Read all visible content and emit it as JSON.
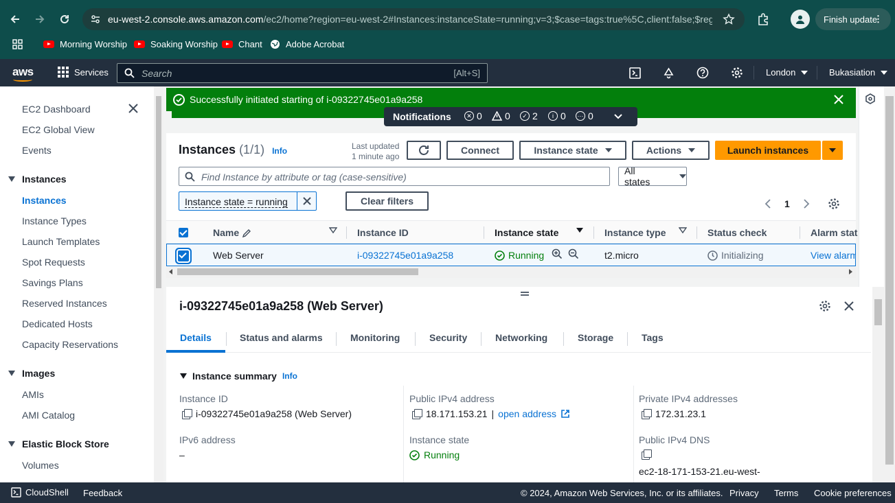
{
  "browser": {
    "url_domain": "eu-west-2.console.aws.amazon.com",
    "url_path": "/ec2/home?region=eu-west-2#Instances:instanceState=running;v=3;$case=tags:true%5C,client:false;$reg...",
    "finish_update": "Finish update",
    "bookmarks": [
      {
        "label": "Morning Worship",
        "icon": "youtube-icon"
      },
      {
        "label": "Soaking Worship",
        "icon": "youtube-icon"
      },
      {
        "label": "Chant",
        "icon": "youtube-icon"
      },
      {
        "label": "Adobe Acrobat",
        "icon": "globe-icon"
      }
    ]
  },
  "aws_header": {
    "logo": "aws",
    "services": "Services",
    "search_placeholder": "Search",
    "search_shortcut": "[Alt+S]",
    "region": "London",
    "account": "Bukasiation"
  },
  "sidebar": {
    "items": [
      {
        "label": "EC2 Dashboard"
      },
      {
        "label": "EC2 Global View"
      },
      {
        "label": "Events"
      }
    ],
    "sections": [
      {
        "title": "Instances",
        "items": [
          "Instances",
          "Instance Types",
          "Launch Templates",
          "Spot Requests",
          "Savings Plans",
          "Reserved Instances",
          "Dedicated Hosts",
          "Capacity Reservations"
        ]
      },
      {
        "title": "Images",
        "items": [
          "AMIs",
          "AMI Catalog"
        ]
      },
      {
        "title": "Elastic Block Store",
        "items": [
          "Volumes"
        ]
      }
    ],
    "active": "Instances"
  },
  "flash": {
    "message": "Successfully initiated starting of i-09322745e01a9a258"
  },
  "notifications": {
    "label": "Notifications",
    "error": "0",
    "warning": "0",
    "success": "2",
    "info": "0",
    "in_progress": "0"
  },
  "instances": {
    "title": "Instances",
    "count": "(1/1)",
    "info": "Info",
    "last_updated_line1": "Last updated",
    "last_updated_line2": "1 minute ago",
    "connect": "Connect",
    "instance_state": "Instance state",
    "actions": "Actions",
    "launch": "Launch instances",
    "find_placeholder": "Find Instance by attribute or tag (case-sensitive)",
    "all_states": "All states",
    "filter_token": "Instance state = running",
    "clear_filters": "Clear filters",
    "page": "1",
    "columns": [
      "Name",
      "Instance ID",
      "Instance state",
      "Instance type",
      "Status check",
      "Alarm stat"
    ],
    "row": {
      "name": "Web Server",
      "id": "i-09322745e01a9a258",
      "state": "Running",
      "type": "t2.micro",
      "status_check": "Initializing",
      "alarm": "View alarm"
    }
  },
  "detail": {
    "title": "i-09322745e01a9a258 (Web Server)",
    "tabs": [
      "Details",
      "Status and alarms",
      "Monitoring",
      "Security",
      "Networking",
      "Storage",
      "Tags"
    ],
    "section": "Instance summary",
    "info": "Info",
    "instance_id_label": "Instance ID",
    "instance_id": "i-09322745e01a9a258 (Web Server)",
    "ipv6_label": "IPv6 address",
    "ipv6": "–",
    "public_ipv4_label": "Public IPv4 address",
    "public_ipv4": "18.171.153.21",
    "open_address": "open address",
    "instance_state_label": "Instance state",
    "instance_state": "Running",
    "private_ipv4_label": "Private IPv4 addresses",
    "private_ipv4": "172.31.23.1",
    "public_dns_label": "Public IPv4 DNS",
    "public_dns": "ec2-18-171-153-21.eu-west-"
  },
  "footer": {
    "cloudshell": "CloudShell",
    "feedback": "Feedback",
    "copyright": "© 2024, Amazon Web Services, Inc. or its affiliates.",
    "privacy": "Privacy",
    "terms": "Terms",
    "cookies": "Cookie preferences"
  },
  "colors": {
    "chrome": "#0e4d4b",
    "aws_header": "#232f3e",
    "success": "#037f0c",
    "primary": "#ff9900",
    "link": "#0972d3"
  }
}
